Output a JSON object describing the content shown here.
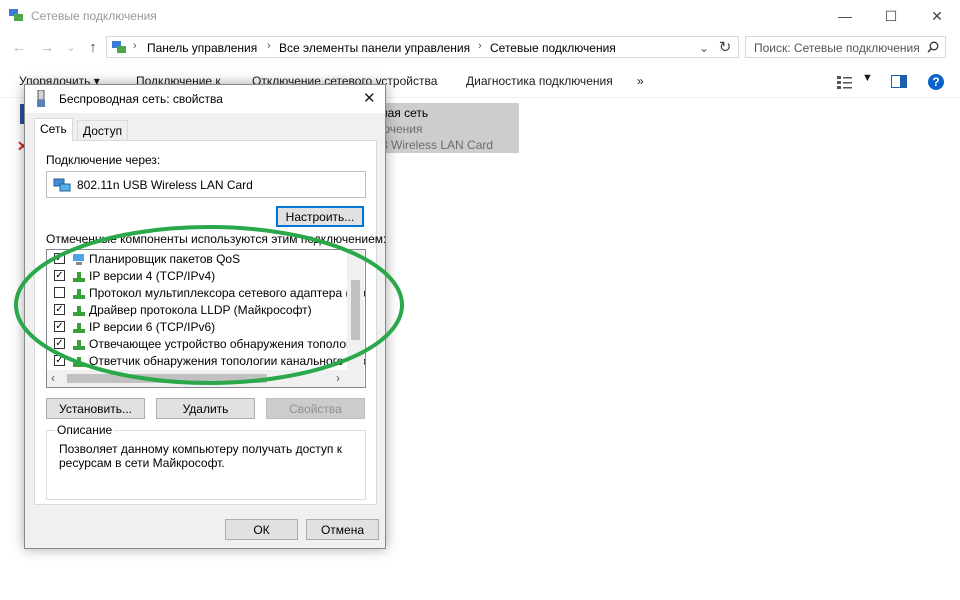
{
  "window": {
    "title": "Сетевые подключения",
    "controls": {
      "minimize": "—",
      "maximize": "☐",
      "close": "✕"
    }
  },
  "nav": {
    "back": "←",
    "forward": "→",
    "dropdown": "⌄",
    "up": "↑",
    "addr_dropdown": "⌄",
    "refresh": "↻",
    "breadcrumb": [
      "Панель управления",
      "Все элементы панели управления",
      "Сетевые подключения"
    ],
    "separator": "›",
    "search_placeholder": "Поиск: Сетевые подключения"
  },
  "toolbar": {
    "items": [
      "Упорядочить ▾",
      "Подключение к",
      "Отключение сетевого устройства",
      "Диагностика подключения",
      "»"
    ],
    "help": "?"
  },
  "adapter": {
    "name": "ная сеть",
    "status": "ючения",
    "device": "3 Wireless LAN Card"
  },
  "dialog": {
    "title": "Беспроводная сеть: свойства",
    "close": "✕",
    "tabs": [
      "Сеть",
      "Доступ"
    ],
    "connect_label": "Подключение через:",
    "device_name": "802.11n USB Wireless LAN Card",
    "configure_button": "Настроить...",
    "components_label": "Отмеченные компоненты используются этим подключением:",
    "components": [
      {
        "label": "Планировщик пакетов QoS",
        "checked": true
      },
      {
        "label": "IP версии 4 (TCP/IPv4)",
        "checked": true
      },
      {
        "label": "Протокол мультиплексора сетевого адаптера (Ма",
        "checked": false
      },
      {
        "label": "Драйвер протокола LLDP (Майкрософт)",
        "checked": true
      },
      {
        "label": "IP версии 6 (TCP/IPv6)",
        "checked": true
      },
      {
        "label": "Отвечающее устройство обнаружения топологии к",
        "checked": true
      },
      {
        "label": "Ответчик обнаружения топологии канального уров",
        "checked": true
      }
    ],
    "install_button": "Установить...",
    "remove_button": "Удалить",
    "properties_button": "Свойства",
    "description_title": "Описание",
    "description_text": [
      "Позволяет данному компьютеру получать доступ к",
      "ресурсам в сети Майкрософт."
    ],
    "ok_button": "ОК",
    "cancel_button": "Отмена"
  },
  "annotation_color": "#2aa84a"
}
